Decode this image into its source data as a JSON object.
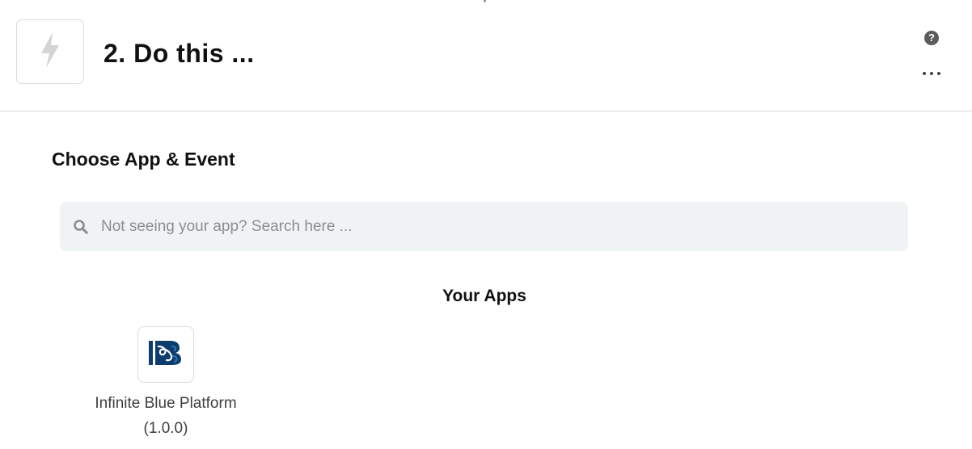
{
  "header": {
    "step_title": "2. Do this ...",
    "icons": {
      "step": "lightning-bolt-icon",
      "help": "help-circle-icon",
      "more": "more-horizontal-icon"
    },
    "help_glyph": "?"
  },
  "main": {
    "section_title": "Choose App & Event",
    "search": {
      "placeholder": "Not seeing your app? Search here ...",
      "value": "",
      "icon": "search-icon"
    },
    "your_apps_title": "Your Apps",
    "apps": [
      {
        "name": "Infinite Blue Platform",
        "version": "(1.0.0)",
        "icon": "infinite-blue-logo-icon"
      }
    ]
  },
  "colors": {
    "search_bg": "#eff3f3",
    "border": "#d8d8d8",
    "logo_dark": "#0c3d6e",
    "logo_light": "#2a78b8",
    "bolt": "#d4d4d4"
  }
}
